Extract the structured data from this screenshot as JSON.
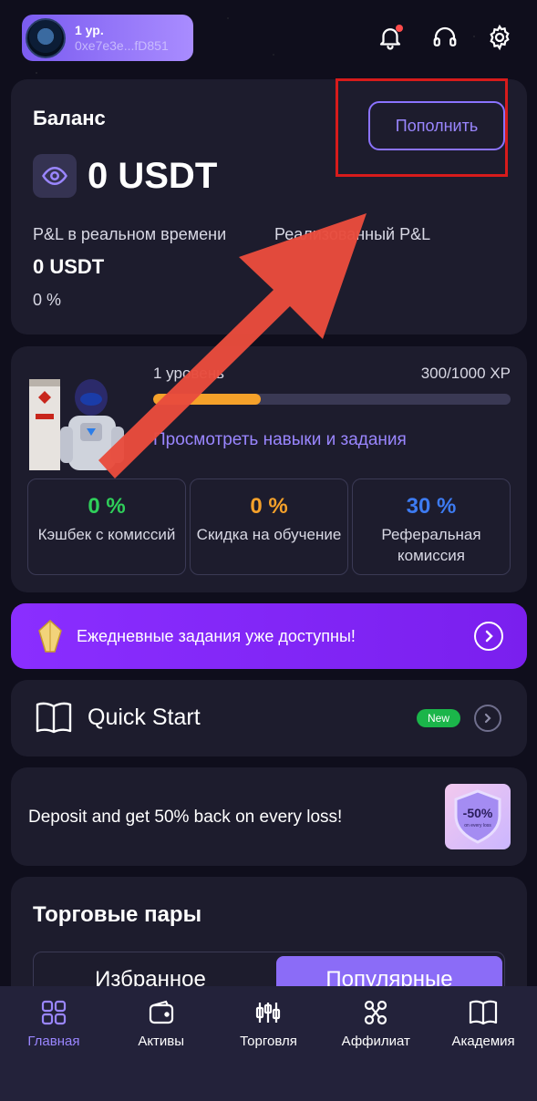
{
  "header": {
    "level": "1 ур.",
    "address": "0xe7e3e...fD851"
  },
  "balance": {
    "title": "Баланс",
    "topup_label": "Пополнить",
    "amount": "0 USDT",
    "pnl_realtime_label": "P&L в реальном времени",
    "pnl_realized_label": "Реализованный P&L",
    "pnl_value": "0 USDT",
    "pnl_percent": "0 %"
  },
  "level_card": {
    "level_label": "1 уровень",
    "xp": "300/1000 XP",
    "xp_progress": 0.3,
    "skills_link": "Просмотреть навыки и задания",
    "stats": [
      {
        "value": "0 %",
        "label": "Кэшбек с комиссий",
        "color": "#2fcf5a"
      },
      {
        "value": "0 %",
        "label": "Скидка на обучение",
        "color": "#f5a12a"
      },
      {
        "value": "30 %",
        "label": "Реферальная комиссия",
        "color": "#3d7bf2"
      }
    ]
  },
  "daily_banner": {
    "text": "Ежедневные задания уже доступны!"
  },
  "quick_start": {
    "title": "Quick Start",
    "badge": "New"
  },
  "deposit_promo": {
    "text": "Deposit and get 50% back on every loss!",
    "image_text": "-50%",
    "image_subtext": "on every loss"
  },
  "trading_pairs": {
    "title": "Торговые пары",
    "tabs": [
      "Избранное",
      "Популярные"
    ],
    "active_tab": "Популярные"
  },
  "bottom_nav": {
    "items": [
      {
        "label": "Главная",
        "icon": "grid-icon",
        "active": true
      },
      {
        "label": "Активы",
        "icon": "wallet-icon",
        "active": false
      },
      {
        "label": "Торговля",
        "icon": "candles-icon",
        "active": false
      },
      {
        "label": "Аффилиат",
        "icon": "share-icon",
        "active": false
      },
      {
        "label": "Академия",
        "icon": "book-icon",
        "active": false
      }
    ]
  },
  "colors": {
    "accent": "#8b6cf7",
    "highlight": "#d71b1b",
    "arrow": "#e84c3d"
  }
}
